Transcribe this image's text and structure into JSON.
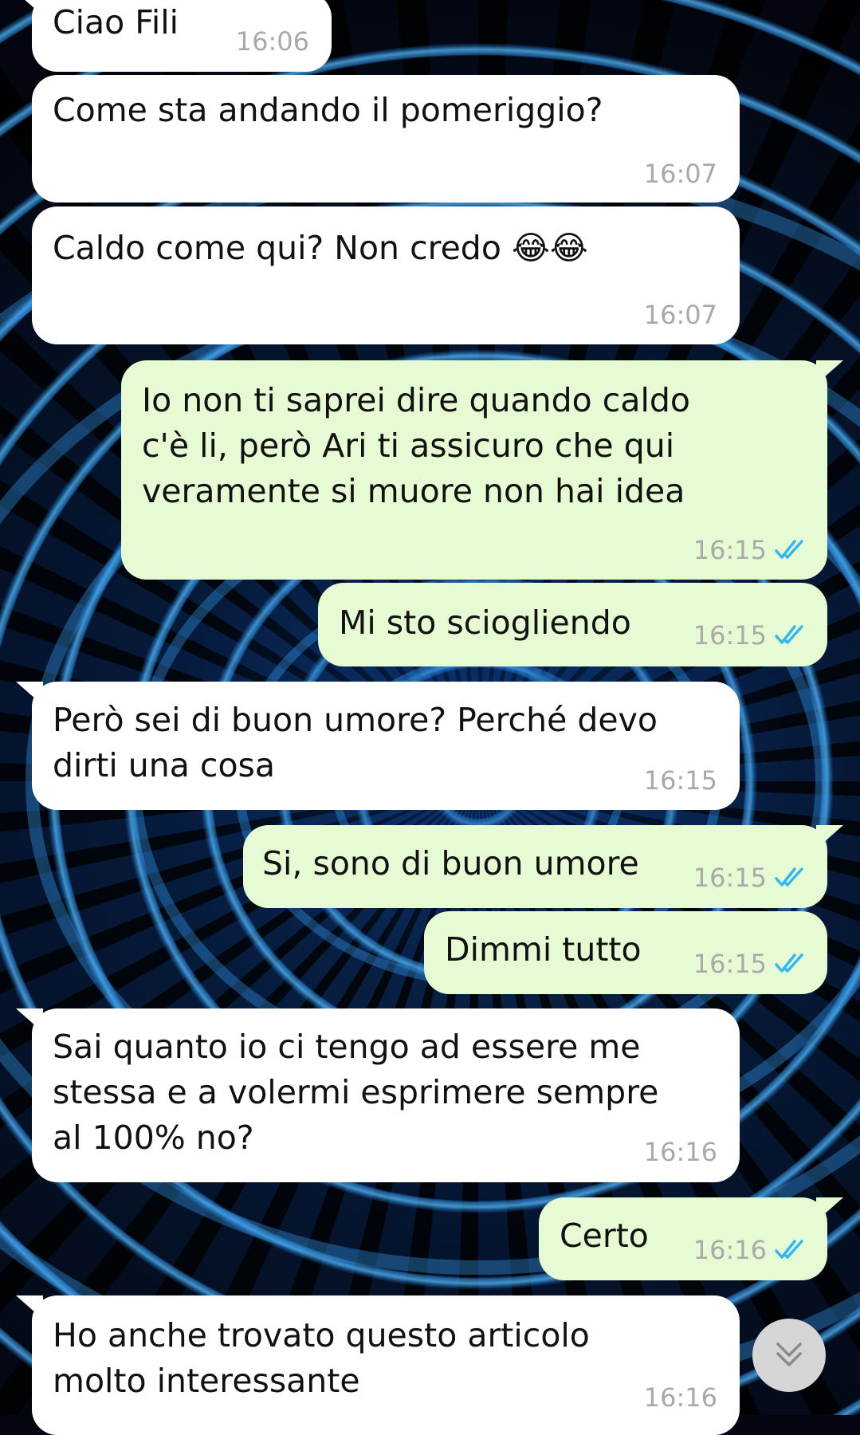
{
  "messages": [
    {
      "id": "m1",
      "direction": "in",
      "text": "Ciao Fili",
      "time": "16:06",
      "read": false
    },
    {
      "id": "m2",
      "direction": "in",
      "text": "Come sta andando il pomeriggio?",
      "time": "16:07",
      "read": false
    },
    {
      "id": "m3",
      "direction": "in",
      "text": "Caldo come qui? Non credo 😂😂",
      "time": "16:07",
      "read": false
    },
    {
      "id": "m4",
      "direction": "out",
      "text": "Io non ti saprei dire quando caldo\nc'è li, però Ari ti assicuro che qui\nveramente si muore non hai idea",
      "time": "16:15",
      "read": true
    },
    {
      "id": "m5",
      "direction": "out",
      "text": "Mi sto sciogliendo",
      "time": "16:15",
      "read": true
    },
    {
      "id": "m6",
      "direction": "in",
      "text": "Però sei di buon umore? Perché devo\ndirti una cosa",
      "time": "16:15",
      "read": false
    },
    {
      "id": "m7",
      "direction": "out",
      "text": "Si, sono di buon umore",
      "time": "16:15",
      "read": true
    },
    {
      "id": "m8",
      "direction": "out",
      "text": "Dimmi tutto",
      "time": "16:15",
      "read": true
    },
    {
      "id": "m9",
      "direction": "in",
      "text": "Sai quanto io ci tengo ad essere me\nstessa e a volermi esprimere sempre\nal 100% no?",
      "time": "16:16",
      "read": false
    },
    {
      "id": "m10",
      "direction": "out",
      "text": "Certo",
      "time": "16:16",
      "read": true
    },
    {
      "id": "m11",
      "direction": "in",
      "text": "Ho anche trovato questo articolo\nmolto interessante",
      "time": "16:16",
      "read": false
    }
  ],
  "colors": {
    "incoming_bubble": "#ffffff",
    "outgoing_bubble": "#e6fbd3",
    "read_check": "#34b7f1",
    "timestamp": "#a9a9a9"
  },
  "icons": {
    "read_receipt": "double-check-icon",
    "scroll_down": "chevron-double-down-icon"
  }
}
